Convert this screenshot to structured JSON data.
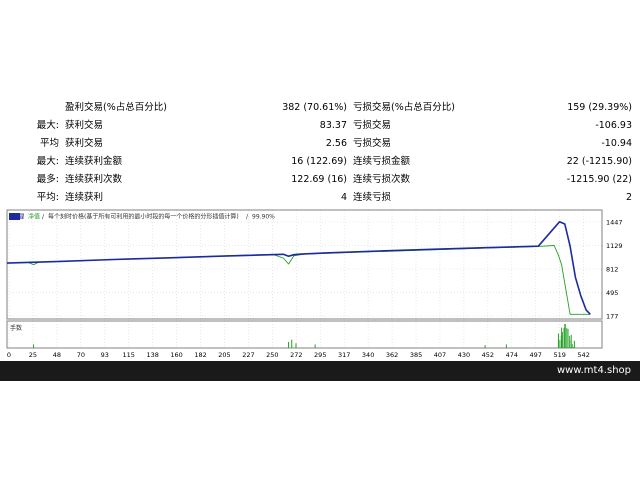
{
  "stats": {
    "rows": [
      {
        "prefix": "",
        "label": "盈利交易(%占总百分比)",
        "value": "382 (70.61%)",
        "label2": "亏损交易(%占总百分比)",
        "value2": "159 (29.39%)"
      },
      {
        "prefix": "最大:",
        "label": "获利交易",
        "value": "83.37",
        "label2": "亏损交易",
        "value2": "-106.93"
      },
      {
        "prefix": "平均",
        "label": "获利交易",
        "value": "2.56",
        "label2": "亏损交易",
        "value2": "-10.94"
      },
      {
        "prefix": "最大:",
        "label": "连续获利金额",
        "value": "16 (122.69)",
        "label2": "连续亏损金额",
        "value2": "22 (-1215.90)"
      },
      {
        "prefix": "最多:",
        "label": "连续获利次数",
        "value": "122.69 (16)",
        "label2": "连续亏损次数",
        "value2": "-1215.90 (22)"
      },
      {
        "prefix": "平均:",
        "label": "连续获利",
        "value": "4",
        "label2": "连续亏损",
        "value2": "2"
      }
    ]
  },
  "chart_data": {
    "type": "line",
    "legend": [
      "余额",
      "净值",
      "每个刻时价格(基于所有可利用的最小时段的每一个价格的分形插值计算)",
      "99.90%"
    ],
    "lot_label": "手数",
    "x_ticks": [
      "0",
      "25",
      "48",
      "70",
      "93",
      "115",
      "138",
      "160",
      "182",
      "205",
      "227",
      "250",
      "272",
      "295",
      "317",
      "340",
      "362",
      "385",
      "407",
      "430",
      "452",
      "474",
      "497",
      "519",
      "542"
    ],
    "y_ticks": [
      "1447",
      "1129",
      "812",
      "495",
      "177"
    ],
    "ylim": [
      177,
      1447
    ],
    "xlim": [
      0,
      560
    ],
    "series": [
      {
        "name": "余额",
        "color": "#1c2aa0",
        "x": [
          0,
          50,
          100,
          150,
          200,
          260,
          265,
          270,
          275,
          300,
          350,
          400,
          450,
          500,
          520,
          525,
          530,
          535,
          540,
          545,
          549
        ],
        "y": [
          892,
          915,
          940,
          962,
          985,
          1010,
          985,
          1005,
          1012,
          1030,
          1055,
          1078,
          1100,
          1120,
          1450,
          1420,
          1120,
          700,
          450,
          260,
          200
        ]
      },
      {
        "name": "净值",
        "color": "#22a022",
        "x": [
          0,
          20,
          25,
          30,
          250,
          260,
          265,
          270,
          280,
          500,
          515,
          519,
          522,
          530,
          549
        ],
        "y": [
          892,
          900,
          870,
          905,
          1010,
          960,
          880,
          990,
          1015,
          1118,
          1130,
          1000,
          870,
          200,
          200
        ]
      }
    ],
    "volume_spikes": [
      {
        "x": 25,
        "v": 0.15
      },
      {
        "x": 265,
        "v": 0.25
      },
      {
        "x": 268,
        "v": 0.35
      },
      {
        "x": 272,
        "v": 0.2
      },
      {
        "x": 290,
        "v": 0.15
      },
      {
        "x": 450,
        "v": 0.12
      },
      {
        "x": 470,
        "v": 0.15
      },
      {
        "x": 519,
        "v": 0.6
      },
      {
        "x": 522,
        "v": 0.85
      },
      {
        "x": 525,
        "v": 1.0
      },
      {
        "x": 528,
        "v": 0.8
      },
      {
        "x": 531,
        "v": 0.55
      },
      {
        "x": 534,
        "v": 0.3
      }
    ]
  },
  "footer": {
    "watermark": "www.mt4.shop"
  },
  "colors": {
    "balance": "#1c2aa0",
    "equity": "#22a022",
    "grid": "#cccccc",
    "frame": "#808080"
  }
}
